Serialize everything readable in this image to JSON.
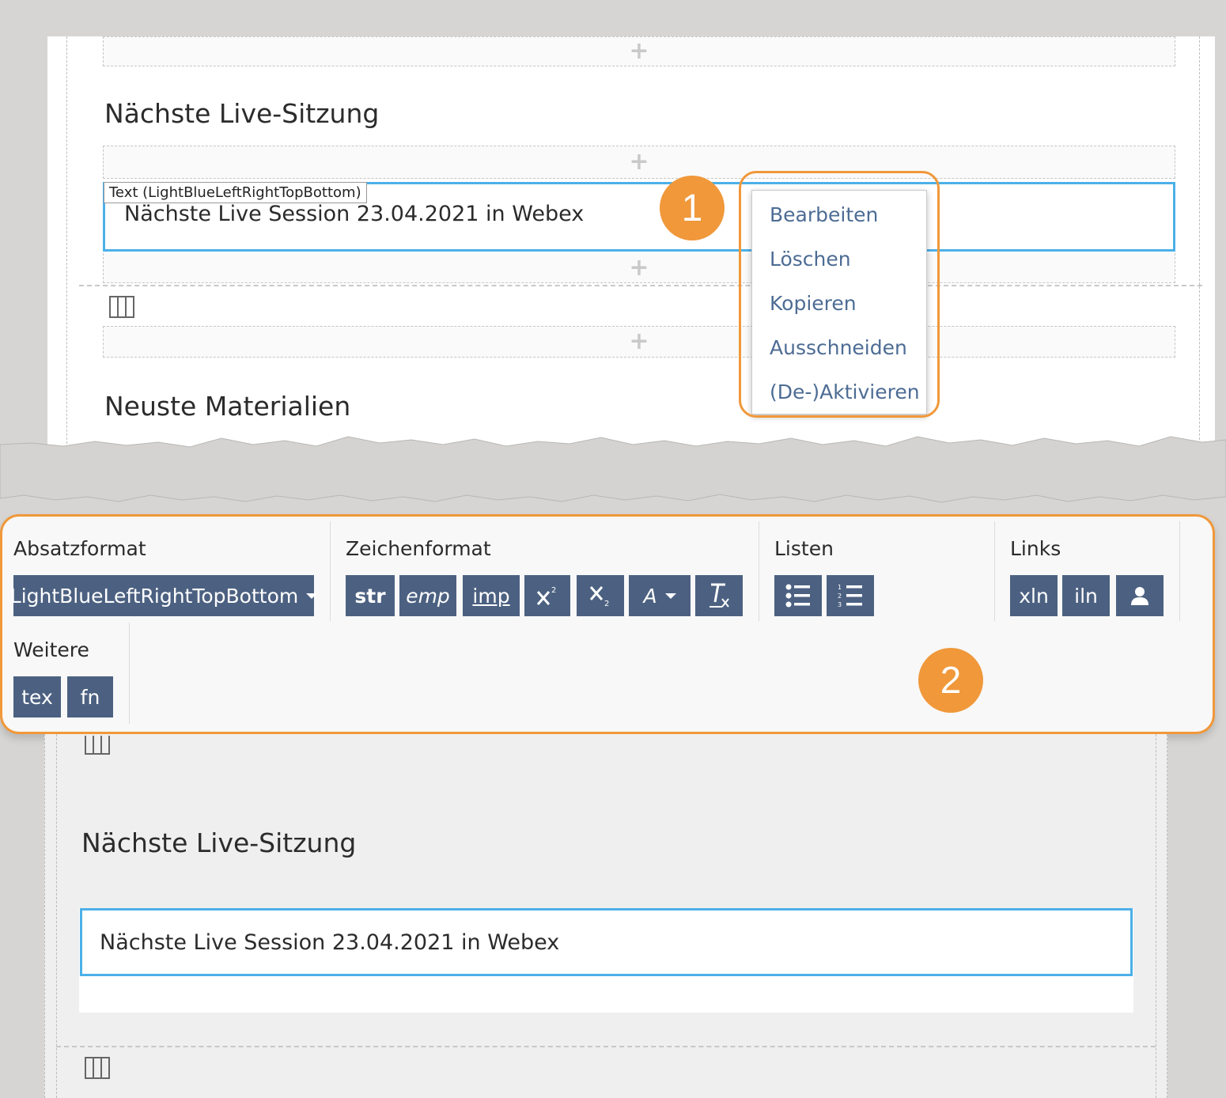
{
  "editor_top": {
    "section1_heading": "Nächste Live-Sitzung",
    "section2_heading": "Neuste Materialien",
    "text_element": {
      "type_label": "Text (LightBlueLeftRightTopBottom)",
      "content": "Nächste Live Session 23.04.2021 in Webex"
    },
    "plus_symbol": "+"
  },
  "context_menu": {
    "items": [
      {
        "label": "Bearbeiten"
      },
      {
        "label": "Löschen"
      },
      {
        "label": "Kopieren"
      },
      {
        "label": "Ausschneiden"
      },
      {
        "label": "(De-)Aktivieren"
      }
    ]
  },
  "callouts": {
    "badge_1": "1",
    "badge_2": "2",
    "color": "#f0983a"
  },
  "toolbar": {
    "absatzformat": {
      "label": "Absatzformat",
      "selected": "LightBlueLeftRightTopBottom"
    },
    "zeichenformat": {
      "label": "Zeichenformat",
      "buttons": {
        "str": "str",
        "emp": "emp",
        "imp": "imp",
        "superscript_icon": "superscript-icon",
        "subscript_icon": "subscript-icon",
        "font_color": "A",
        "clear_format_icon": "clear-format-icon"
      }
    },
    "listen": {
      "label": "Listen",
      "bullet_icon": "bullet-list-icon",
      "numbered_icon": "numbered-list-icon"
    },
    "links": {
      "label": "Links",
      "xln": "xln",
      "iln": "iln",
      "user_icon": "user-icon"
    },
    "weitere": {
      "label": "Weitere",
      "tex": "tex",
      "fn": "fn"
    },
    "button_color": "#4c6181"
  },
  "editor_bottom": {
    "section_heading": "Nächste Live-Sitzung",
    "text_content": "Nächste Live Session 23.04.2021 in Webex"
  },
  "colors": {
    "selection_border": "#4cb0e8",
    "menu_link": "#4d6c94"
  }
}
